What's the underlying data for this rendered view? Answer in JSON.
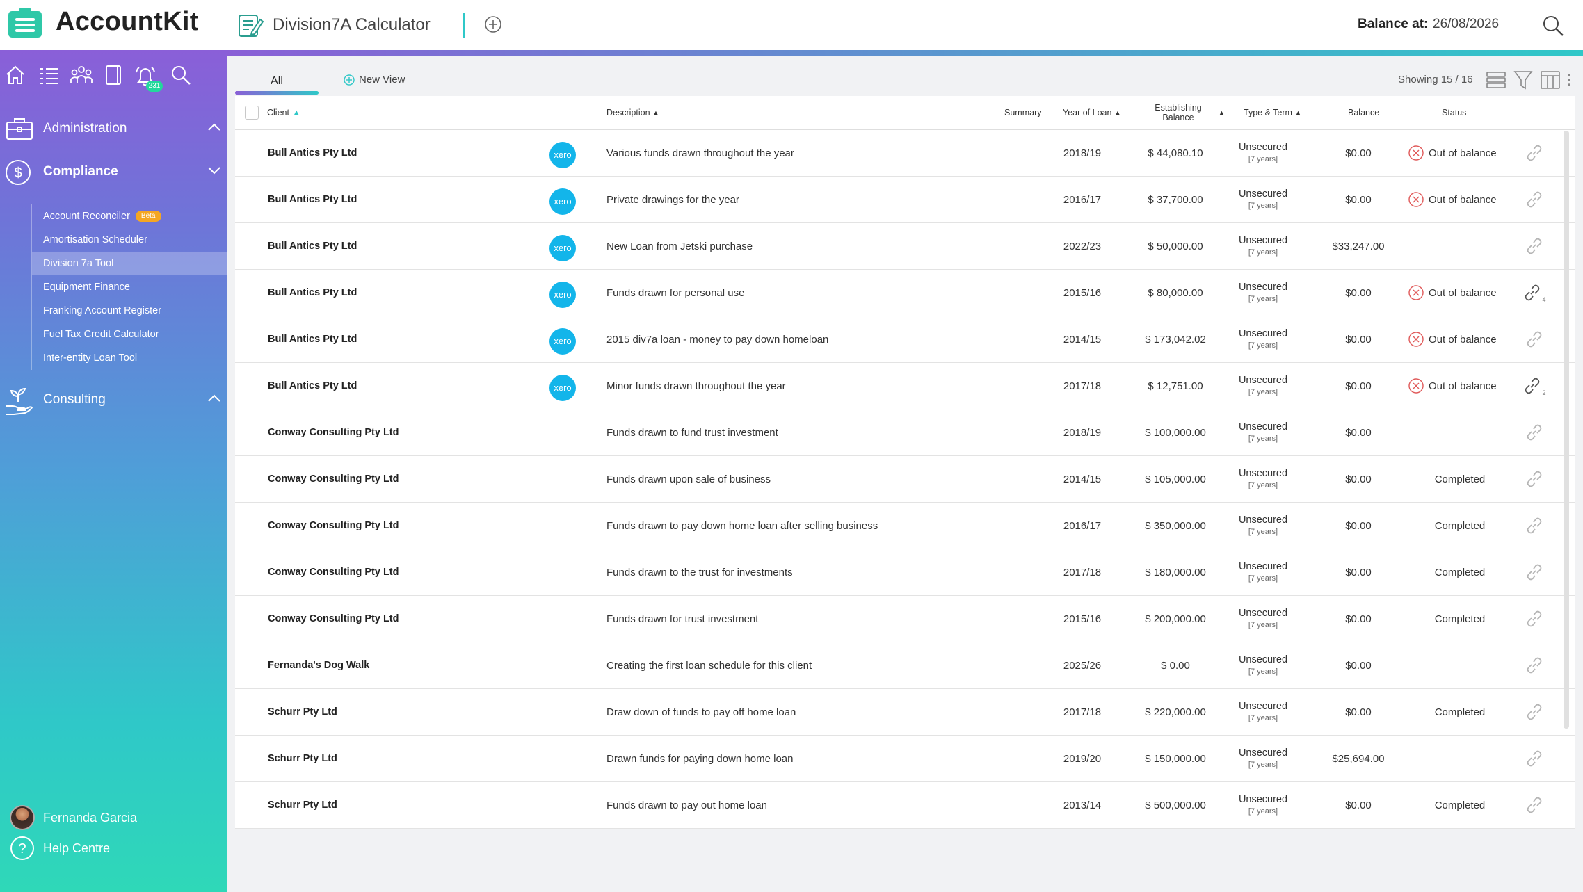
{
  "brand": {
    "name": "AccountKit",
    "accent": "#2fc8c8",
    "purple": "#8a5fd6"
  },
  "header": {
    "app_title": "Division7A Calculator",
    "balance_label": "Balance at:",
    "balance_date": "26/08/2026"
  },
  "sidebar": {
    "notifications_count": "231",
    "sections": [
      {
        "label": "Administration",
        "icon": "briefcase-icon",
        "expanded": false
      },
      {
        "label": "Compliance",
        "icon": "dollar-circle-icon",
        "expanded": true
      },
      {
        "label": "Consulting",
        "icon": "plant-hand-icon",
        "expanded": false
      }
    ],
    "compliance_items": [
      {
        "label": "Account Reconciler",
        "badge": "Beta"
      },
      {
        "label": "Amortisation Scheduler"
      },
      {
        "label": "Division 7a Tool",
        "active": true
      },
      {
        "label": "Equipment Finance"
      },
      {
        "label": "Franking Account Register"
      },
      {
        "label": "Fuel Tax Credit Calculator"
      },
      {
        "label": "Inter-entity Loan Tool"
      }
    ],
    "user_name": "Fernanda Garcia",
    "help_label": "Help Centre"
  },
  "views": {
    "tab_all": "All",
    "new_view": "New View",
    "showing": "Showing 15 / 16"
  },
  "table": {
    "columns": {
      "client": "Client",
      "description": "Description",
      "summary": "Summary",
      "year": "Year of Loan",
      "est1": "Establishing",
      "est2": "Balance",
      "type": "Type & Term",
      "balance": "Balance",
      "status": "Status"
    },
    "xero_label": "xero",
    "rows": [
      {
        "client": "Bull Antics Pty Ltd",
        "xero": true,
        "desc": "Various funds drawn throughout the year",
        "year": "2018/19",
        "est": "$ 44,080.10",
        "type": "Unsecured",
        "term": "[7 years]",
        "balance": "$0.00",
        "status": "Out of balance",
        "status_kind": "error"
      },
      {
        "client": "Bull Antics Pty Ltd",
        "xero": true,
        "desc": "Private drawings for the year",
        "year": "2016/17",
        "est": "$ 37,700.00",
        "type": "Unsecured",
        "term": "[7 years]",
        "balance": "$0.00",
        "status": "Out of balance",
        "status_kind": "error"
      },
      {
        "client": "Bull Antics Pty Ltd",
        "xero": true,
        "desc": "New Loan from Jetski purchase",
        "year": "2022/23",
        "est": "$ 50,000.00",
        "type": "Unsecured",
        "term": "[7 years]",
        "balance": "$33,247.00",
        "status": "",
        "status_kind": "none"
      },
      {
        "client": "Bull Antics Pty Ltd",
        "xero": true,
        "desc": "Funds drawn for personal use",
        "year": "2015/16",
        "est": "$ 80,000.00",
        "type": "Unsecured",
        "term": "[7 years]",
        "balance": "$0.00",
        "status": "Out of balance",
        "status_kind": "error",
        "links": "4"
      },
      {
        "client": "Bull Antics Pty Ltd",
        "xero": true,
        "desc": "2015 div7a loan - money to pay down homeloan",
        "year": "2014/15",
        "est": "$ 173,042.02",
        "type": "Unsecured",
        "term": "[7 years]",
        "balance": "$0.00",
        "status": "Out of balance",
        "status_kind": "error"
      },
      {
        "client": "Bull Antics Pty Ltd",
        "xero": true,
        "desc": "Minor funds drawn throughout the year",
        "year": "2017/18",
        "est": "$ 12,751.00",
        "type": "Unsecured",
        "term": "[7 years]",
        "balance": "$0.00",
        "status": "Out of balance",
        "status_kind": "error",
        "links": "2"
      },
      {
        "client": "Conway Consulting Pty Ltd",
        "xero": false,
        "desc": "Funds drawn to fund trust investment",
        "year": "2018/19",
        "est": "$ 100,000.00",
        "type": "Unsecured",
        "term": "[7 years]",
        "balance": "$0.00",
        "status": "",
        "status_kind": "none"
      },
      {
        "client": "Conway Consulting Pty Ltd",
        "xero": false,
        "desc": "Funds drawn upon sale of business",
        "year": "2014/15",
        "est": "$ 105,000.00",
        "type": "Unsecured",
        "term": "[7 years]",
        "balance": "$0.00",
        "status": "Completed",
        "status_kind": "done"
      },
      {
        "client": "Conway Consulting Pty Ltd",
        "xero": false,
        "desc": "Funds drawn to pay down home loan after selling business",
        "year": "2016/17",
        "est": "$ 350,000.00",
        "type": "Unsecured",
        "term": "[7 years]",
        "balance": "$0.00",
        "status": "Completed",
        "status_kind": "done"
      },
      {
        "client": "Conway Consulting Pty Ltd",
        "xero": false,
        "desc": "Funds drawn to the trust for investments",
        "year": "2017/18",
        "est": "$ 180,000.00",
        "type": "Unsecured",
        "term": "[7 years]",
        "balance": "$0.00",
        "status": "Completed",
        "status_kind": "done"
      },
      {
        "client": "Conway Consulting Pty Ltd",
        "xero": false,
        "desc": "Funds drawn for trust investment",
        "year": "2015/16",
        "est": "$ 200,000.00",
        "type": "Unsecured",
        "term": "[7 years]",
        "balance": "$0.00",
        "status": "Completed",
        "status_kind": "done"
      },
      {
        "client": "Fernanda's Dog Walk",
        "xero": false,
        "desc": "Creating the first loan schedule for this client",
        "year": "2025/26",
        "est": "$ 0.00",
        "type": "Unsecured",
        "term": "[7 years]",
        "balance": "$0.00",
        "status": "",
        "status_kind": "none"
      },
      {
        "client": "Schurr Pty Ltd",
        "xero": false,
        "desc": "Draw down of funds to pay off home loan",
        "year": "2017/18",
        "est": "$ 220,000.00",
        "type": "Unsecured",
        "term": "[7 years]",
        "balance": "$0.00",
        "status": "Completed",
        "status_kind": "done"
      },
      {
        "client": "Schurr Pty Ltd",
        "xero": false,
        "desc": "Drawn funds for paying down home loan",
        "year": "2019/20",
        "est": "$ 150,000.00",
        "type": "Unsecured",
        "term": "[7 years]",
        "balance": "$25,694.00",
        "status": "",
        "status_kind": "none"
      },
      {
        "client": "Schurr Pty Ltd",
        "xero": false,
        "desc": "Funds drawn to pay out home loan",
        "year": "2013/14",
        "est": "$ 500,000.00",
        "type": "Unsecured",
        "term": "[7 years]",
        "balance": "$0.00",
        "status": "Completed",
        "status_kind": "done"
      }
    ]
  }
}
